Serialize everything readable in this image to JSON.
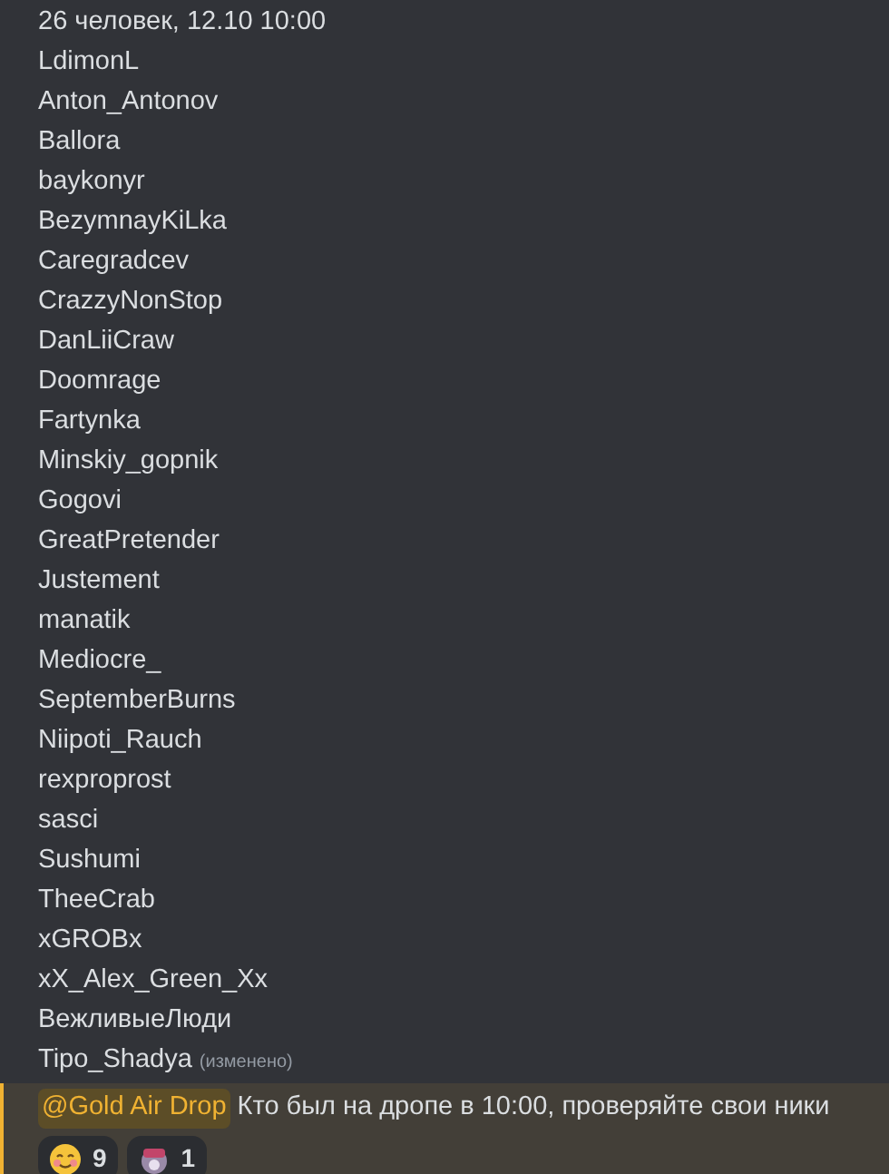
{
  "header": "26 человек, 12.10 10:00",
  "names": [
    "LdimonL",
    "Anton_Antonov",
    "Ballora",
    "baykonyr",
    "BezymnayKiLka",
    "Caregradcev",
    "CrazzyNonStop",
    "DanLiiCraw",
    "Doomrage",
    "Fartynka",
    "Minskiy_gopnik",
    "Gogovi",
    "GreatPretender",
    "Justement",
    "manatik",
    "Mediocre_",
    "SeptemberBurns",
    "Niipoti_Rauch",
    "rexproprost",
    "sasci",
    "Sushumi",
    "TheeCrab",
    "xGROBx",
    "xX_Alex_Green_Xx",
    "ВежливыеЛюди",
    "Tipo_Shadya"
  ],
  "edited_label": "(изменено)",
  "mention_message": {
    "mention": "@Gold Air Drop",
    "text": "Кто был на дропе в 10:00, проверяйте свои ники"
  },
  "reactions": [
    {
      "kind": "smile",
      "count": "9"
    },
    {
      "kind": "custom",
      "count": "1"
    }
  ]
}
